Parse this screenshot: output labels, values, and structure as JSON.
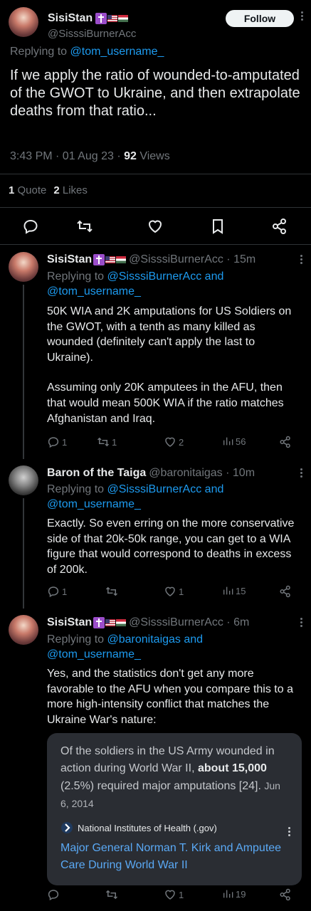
{
  "main_tweet": {
    "author_name": "SisiStan",
    "author_handle": "@SisssiBurnerAcc",
    "follow_label": "Follow",
    "replying_prefix": "Replying to ",
    "replying_to": "@tom_username_",
    "text": "If we apply the ratio of wounded-to-amputated of the GWOT to Ukraine, and then extrapolate deaths from that ratio...",
    "time": "3:43 PM · 01 Aug 23 · ",
    "views_count": "92",
    "views_label": " Views",
    "quote_count": "1",
    "quote_label": " Quote",
    "likes_count": "2",
    "likes_label": " Likes"
  },
  "replies": [
    {
      "author_name": "SisiStan",
      "author_handle": "@SisssiBurnerAcc · 15m",
      "replying_prefix": "Replying to ",
      "replying_line1": "@SisssiBurnerAcc and",
      "replying_line2": "@tom_username_",
      "paragraphs": [
        "50K WIA and 2K amputations for US Soldiers on the GWOT, with a tenth as many killed as wounded (definitely can't apply the last to Ukraine).",
        "Assuming only 20K amputees in the AFU, then that would mean 500K WIA if the ratio matches Afghanistan and Iraq."
      ],
      "replies_count": "1",
      "retweets_count": "1",
      "likes_count": "2",
      "views_count": "56"
    },
    {
      "author_name": "Baron of the Taiga",
      "author_handle": "@baronitaigas · 10m",
      "replying_prefix": "Replying to ",
      "replying_line1": "@SisssiBurnerAcc and",
      "replying_line2": "@tom_username_",
      "paragraphs": [
        "Exactly. So even erring on the more conservative side of that 20k-50k range, you can get to a WIA figure that would correspond to deaths in excess of 200k."
      ],
      "replies_count": "1",
      "retweets_count": "",
      "likes_count": "1",
      "views_count": "15"
    },
    {
      "author_name": "SisiStan",
      "author_handle": "@SisssiBurnerAcc · 6m",
      "replying_prefix": "Replying to ",
      "replying_line1": "@baronitaigas and",
      "replying_line2": "@tom_username_",
      "paragraphs": [
        "Yes, and the statistics don't get any more favorable to the AFU when you compare this to a more high-intensity conflict that matches the Ukraine War's nature:"
      ],
      "card": {
        "quote_pre": "Of the soldiers in the US Army wounded in action during World War II, ",
        "quote_bold": "about 15,000",
        "quote_post": " (2.5%) required major amputations [24].",
        "date": "Jun 6, 2014",
        "source": "National Institutes of Health (.gov)",
        "link_title": "Major General Norman T. Kirk and Amputee Care During World War II"
      },
      "replies_count": "",
      "retweets_count": "",
      "likes_count": "1",
      "views_count": "19"
    }
  ],
  "icons": [
    "reply-icon",
    "retweet-icon",
    "like-icon",
    "bookmark-icon",
    "share-icon",
    "views-icon",
    "more-icon"
  ],
  "colors": {
    "background": "#000000",
    "accent": "#1d9bf0",
    "text": "#e7e9ea",
    "muted": "#71767b",
    "card": "#2a2d33"
  }
}
